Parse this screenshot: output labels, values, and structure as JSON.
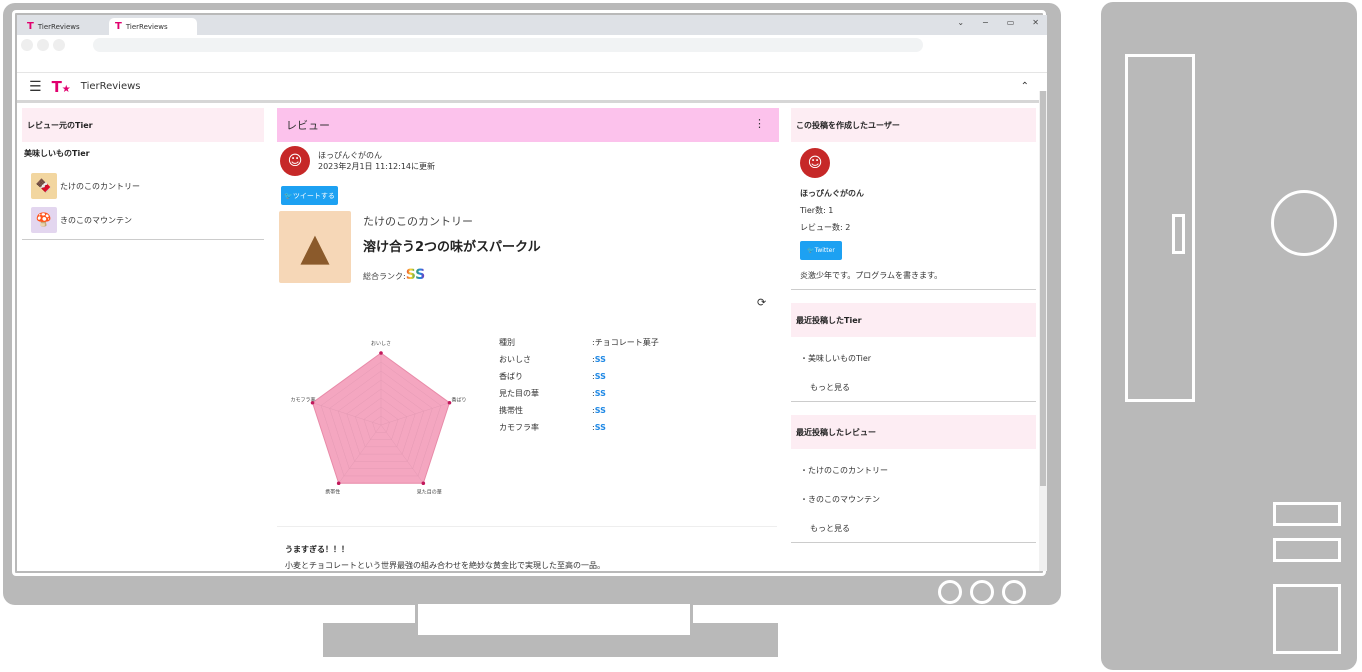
{
  "browser": {
    "tabs": [
      {
        "label": "TierReviews",
        "icon": "T"
      },
      {
        "label": "TierReviews",
        "icon": "T"
      }
    ],
    "window_controls": [
      "⌄",
      "−",
      "▭",
      "✕"
    ]
  },
  "appbar": {
    "logo": "T",
    "logo_star": "★",
    "app_name": "TierReviews",
    "menu_icon": "☰",
    "collapse_icon": "⌃"
  },
  "left": {
    "header": "レビュー元のTier",
    "tier_name": "美味しいものTier",
    "items": [
      {
        "label": "たけのこのカントリー",
        "icon": "🍫"
      },
      {
        "label": "きのこのマウンテン",
        "icon": "🍄"
      }
    ]
  },
  "review": {
    "header": "レビュー",
    "menu_icon": "⋮",
    "user": "ほっぴんぐがのん",
    "updated": "2023年2月1日 11:12:14に更新",
    "tweet_button": "ツイートする",
    "product_category": "たけのこのカントリー",
    "product_title": "溶け合う2つの味がスパークル",
    "rank_label": "総合ランク:",
    "rank_value": "SS",
    "refresh_icon": "⟳",
    "radar_labels": [
      "おいしさ",
      "香ばり",
      "見た目の華",
      "携帯性",
      "カモフラ率"
    ],
    "radar_values": [
      1,
      1,
      1,
      1,
      1
    ],
    "scores": [
      {
        "key": "種別",
        "value": "チョコレート菓子"
      },
      {
        "key": "おいしさ",
        "value": "SS"
      },
      {
        "key": "香ばり",
        "value": "SS"
      },
      {
        "key": "見た目の華",
        "value": "SS"
      },
      {
        "key": "携帯性",
        "value": "SS"
      },
      {
        "key": "カモフラ率",
        "value": "SS"
      }
    ],
    "comment_title": "うますぎる！！！",
    "comment_body": "小麦とチョコレートという世界最強の組み合わせを絶妙な黄金比で実現した至高の一品。"
  },
  "right": {
    "user_card": {
      "header": "この投稿を作成したユーザー",
      "name": "ほっぴんぐがのん",
      "tier_count": "Tier数: 1",
      "review_count": "レビュー数: 2",
      "twitter_button": "Twitter",
      "bio": "炎激少年です。プログラムを書きます。"
    },
    "recent_tiers": {
      "header": "最近投稿したTier",
      "items": [
        "・美味しいものTier"
      ],
      "more": "もっと見る"
    },
    "recent_reviews": {
      "header": "最近投稿したレビュー",
      "items": [
        "・たけのこのカントリー",
        "・きのこのマウンテン"
      ],
      "more": "もっと見る"
    }
  }
}
